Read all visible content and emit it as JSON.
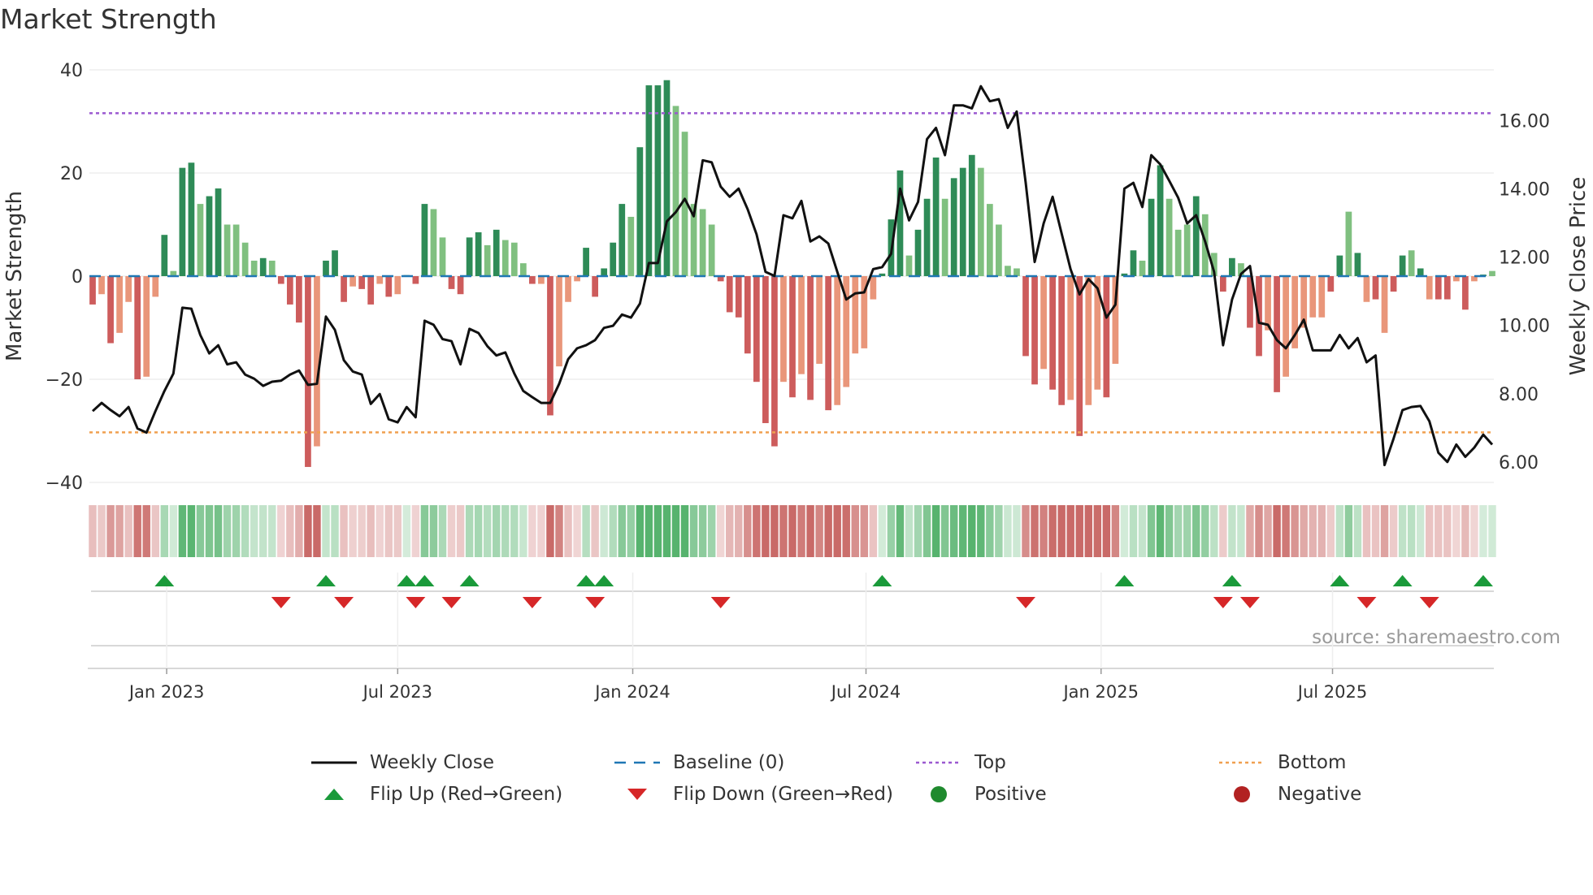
{
  "title": "Market Strength",
  "source": "source: sharemaestro.com",
  "colors": {
    "strong_pos": "#2e8b57",
    "weak_pos": "#80c080",
    "strong_neg": "#cd5c5c",
    "weak_neg": "#e9967a",
    "line": "#111111",
    "baseline": "#1f77b4",
    "top": "#9b59d0",
    "bottom": "#f0a050",
    "flip_up": "#1a9a3a",
    "flip_down": "#d62728"
  },
  "chart_data": {
    "type": "bar",
    "title": "Market Strength",
    "ylabel": "Market Strength",
    "y2label": "Weekly Close Price",
    "ylim": [
      -40,
      40
    ],
    "y2lim": [
      5.4,
      17.49
    ],
    "yticks": [
      "40",
      "20",
      "0",
      "−20",
      "−40"
    ],
    "ytick_values": [
      40,
      20,
      0,
      -20,
      -40
    ],
    "y2ticks": [
      "16.00",
      "14.00",
      "12.00",
      "10.00",
      "8.00",
      "6.00"
    ],
    "y2tick_values": [
      16,
      14,
      12,
      10,
      8,
      6
    ],
    "xticks": [
      {
        "label": "Jan 2023",
        "week": 8.25
      },
      {
        "label": "Jul 2023",
        "week": 34
      },
      {
        "label": "Jan 2024",
        "week": 60.2
      },
      {
        "label": "Jul 2024",
        "week": 86.2
      },
      {
        "label": "Jan 2025",
        "week": 112.4
      },
      {
        "label": "Jul 2025",
        "week": 138.2
      }
    ],
    "top_level": 31.6,
    "bottom_level": -30.3,
    "strength": [
      -5.5,
      -3.5,
      -13,
      -11,
      -5,
      -20,
      -19.5,
      -4,
      8,
      1,
      21,
      22,
      14,
      15.5,
      17,
      10,
      10,
      6.5,
      3,
      3.5,
      3,
      -1.5,
      -5.5,
      -9,
      -37,
      -33,
      3,
      5,
      -5,
      -2,
      -2.5,
      -5.5,
      -1.5,
      -4,
      -3.5,
      0.2,
      -1.5,
      14,
      13,
      7.5,
      -2.5,
      -3.5,
      7.5,
      8.5,
      6,
      9,
      7,
      6.5,
      2.5,
      -1.5,
      -1.5,
      -27,
      -17.5,
      -5,
      -1,
      5.5,
      -4,
      1.5,
      6.5,
      14,
      11.5,
      25,
      37,
      37,
      38,
      33,
      28,
      14,
      13,
      10,
      -1,
      -7,
      -8,
      -15,
      -20.5,
      -28.5,
      -33,
      -20.5,
      -23.5,
      -19,
      -24,
      -17,
      -26,
      -25,
      -21.5,
      -15,
      -14,
      -4.5,
      0.5,
      11,
      20.5,
      4,
      9,
      15,
      23,
      15,
      19,
      21,
      23.5,
      21,
      14,
      10,
      2,
      1.5,
      -15.5,
      -21,
      -18,
      -22,
      -25,
      -24,
      -31,
      -25,
      -22,
      -23.5,
      -17,
      0.5,
      5,
      3,
      15,
      21.5,
      15,
      9,
      10,
      15.5,
      12,
      4.5,
      -3,
      3.5,
      2.5,
      -10,
      -15.5,
      -10.5,
      -22.5,
      -19.5,
      -14,
      -10,
      -8,
      -8,
      -3,
      4,
      12.5,
      4.5,
      -5,
      -4.5,
      -11,
      -3,
      4,
      5,
      1.5,
      -4.5,
      -4.5,
      -4.5,
      -1,
      -6.5,
      -1,
      0.3,
      1
    ],
    "strong": [
      1,
      0,
      1,
      0,
      0,
      1,
      0,
      0,
      1,
      0,
      1,
      1,
      0,
      1,
      1,
      0,
      0,
      0,
      0,
      1,
      0,
      1,
      1,
      1,
      1,
      0,
      1,
      1,
      1,
      0,
      1,
      1,
      0,
      1,
      0,
      1,
      1,
      1,
      0,
      0,
      1,
      1,
      1,
      1,
      0,
      1,
      0,
      0,
      0,
      1,
      0,
      1,
      0,
      0,
      0,
      1,
      1,
      1,
      1,
      1,
      0,
      1,
      1,
      1,
      1,
      0,
      0,
      0,
      0,
      0,
      1,
      1,
      1,
      1,
      1,
      1,
      1,
      0,
      1,
      0,
      1,
      0,
      1,
      0,
      0,
      0,
      0,
      0,
      1,
      1,
      1,
      0,
      1,
      1,
      1,
      0,
      1,
      1,
      1,
      0,
      0,
      0,
      0,
      0,
      1,
      1,
      0,
      1,
      1,
      0,
      1,
      0,
      0,
      1,
      0,
      1,
      1,
      0,
      1,
      1,
      0,
      0,
      0,
      1,
      0,
      0,
      1,
      1,
      0,
      1,
      1,
      0,
      1,
      0,
      0,
      0,
      0,
      0,
      1,
      1,
      0,
      1,
      0,
      1,
      0,
      1,
      1,
      0,
      1,
      0,
      1,
      1,
      0,
      1,
      0,
      1
    ],
    "weekly_close": [
      7.49,
      7.73,
      7.52,
      7.34,
      7.61,
      6.98,
      6.86,
      7.49,
      8.08,
      8.59,
      10.52,
      10.49,
      9.72,
      9.18,
      9.42,
      8.86,
      8.92,
      8.56,
      8.44,
      8.23,
      8.35,
      8.38,
      8.56,
      8.68,
      8.26,
      8.29,
      10.26,
      9.87,
      8.98,
      8.65,
      8.56,
      7.7,
      7.99,
      7.25,
      7.16,
      7.61,
      7.31,
      10.14,
      10.02,
      9.6,
      9.54,
      8.86,
      9.9,
      9.78,
      9.39,
      9.12,
      9.21,
      8.59,
      8.08,
      7.9,
      7.73,
      7.73,
      8.29,
      9.01,
      9.33,
      9.42,
      9.57,
      9.93,
      9.99,
      10.32,
      10.23,
      10.64,
      11.83,
      11.83,
      13.05,
      13.32,
      13.71,
      13.2,
      14.84,
      14.78,
      14.07,
      13.77,
      14.01,
      13.41,
      12.67,
      11.57,
      11.45,
      13.23,
      13.14,
      13.65,
      12.46,
      12.61,
      12.4,
      11.57,
      10.76,
      10.94,
      10.97,
      11.65,
      11.71,
      12.1,
      14.01,
      13.08,
      13.62,
      15.46,
      15.79,
      14.99,
      16.45,
      16.45,
      16.36,
      17.01,
      16.57,
      16.63,
      15.79,
      16.27,
      14.18,
      11.86,
      12.99,
      13.77,
      12.7,
      11.65,
      10.91,
      11.36,
      11.09,
      10.23,
      10.61,
      14.01,
      14.18,
      13.47,
      14.99,
      14.72,
      14.24,
      13.74,
      12.99,
      13.23,
      12.46,
      11.57,
      9.42,
      10.76,
      11.51,
      11.74,
      10.08,
      10.02,
      9.57,
      9.33,
      9.72,
      10.17,
      9.27,
      9.27,
      9.27,
      9.72,
      9.33,
      9.63,
      8.92,
      9.12,
      5.91,
      6.68,
      7.52,
      7.61,
      7.64,
      7.19,
      6.27,
      6.0,
      6.51,
      6.15,
      6.42,
      6.8,
      6.51
    ],
    "flip_up_weeks": [
      8,
      26,
      35,
      37,
      42,
      55,
      57,
      88,
      115,
      127,
      139,
      146,
      155
    ],
    "flip_down_weeks": [
      21,
      28,
      36,
      40,
      49,
      56,
      70,
      104,
      126,
      129,
      142,
      149
    ],
    "legend": [
      {
        "label": "Weekly Close",
        "kind": "line"
      },
      {
        "label": "Baseline (0)",
        "kind": "dash"
      },
      {
        "label": "Top",
        "kind": "dot-top"
      },
      {
        "label": "Bottom",
        "kind": "dot-bottom"
      },
      {
        "label": "Flip Up (Red→Green)",
        "kind": "tri-up"
      },
      {
        "label": "Flip Down (Green→Red)",
        "kind": "tri-down"
      },
      {
        "label": "Positive",
        "kind": "dot-pos"
      },
      {
        "label": "Negative",
        "kind": "dot-neg"
      }
    ],
    "legend_placement": "bottom"
  }
}
